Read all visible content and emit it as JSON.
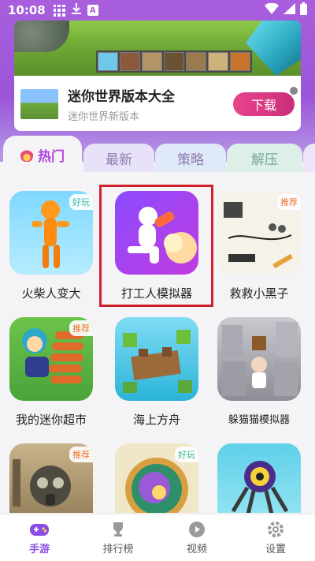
{
  "status_bar": {
    "time": "10:08",
    "left_icons": [
      "grid-icon",
      "download-icon",
      "a-icon"
    ],
    "right_icons": [
      "wifi-icon",
      "signal-icon",
      "battery-icon"
    ]
  },
  "banner": {
    "title": "迷你世界版本大全",
    "subtitle": "迷你世界新版本",
    "button": "下载"
  },
  "tabs": [
    {
      "label": "热门",
      "active": true,
      "icon": "fire-icon"
    },
    {
      "label": "最新",
      "active": false
    },
    {
      "label": "策略",
      "active": false
    },
    {
      "label": "解压",
      "active": false
    }
  ],
  "games": [
    {
      "name": "火柴人变大",
      "badge": "好玩",
      "badge_type": "good",
      "icon": "orange-stickman-icon"
    },
    {
      "name": "打工人模拟器",
      "badge": "",
      "badge_type": "",
      "icon": "worker-runner-icon"
    },
    {
      "name": "救救小黑子",
      "badge": "推荐",
      "badge_type": "rec",
      "icon": "drawing-sketch-icon"
    },
    {
      "name": "我的迷你超市",
      "badge": "推荐",
      "badge_type": "rec",
      "icon": "burger-stack-icon"
    },
    {
      "name": "海上方舟",
      "badge": "",
      "badge_type": "",
      "icon": "island-raft-icon"
    },
    {
      "name": "躲猫猫模拟器",
      "badge": "",
      "badge_type": "",
      "icon": "hide-and-seek-icon"
    },
    {
      "name": "",
      "badge": "推荐",
      "badge_type": "rec",
      "icon": "gas-mask-icon"
    },
    {
      "name": "",
      "badge": "好玩",
      "badge_type": "good",
      "icon": "swirl-orb-icon"
    },
    {
      "name": "",
      "badge": "",
      "badge_type": "",
      "icon": "robot-spider-icon"
    }
  ],
  "bottom_nav": [
    {
      "label": "手游",
      "active": true,
      "icon": "gamepad-icon"
    },
    {
      "label": "排行榜",
      "active": false,
      "icon": "trophy-icon"
    },
    {
      "label": "视频",
      "active": false,
      "icon": "play-icon"
    },
    {
      "label": "设置",
      "active": false,
      "icon": "gear-icon"
    }
  ],
  "colors": {
    "accent": "#b041e0",
    "header": "#a95fdd",
    "download": "#e9438c",
    "highlight_box": "#d0202a"
  }
}
